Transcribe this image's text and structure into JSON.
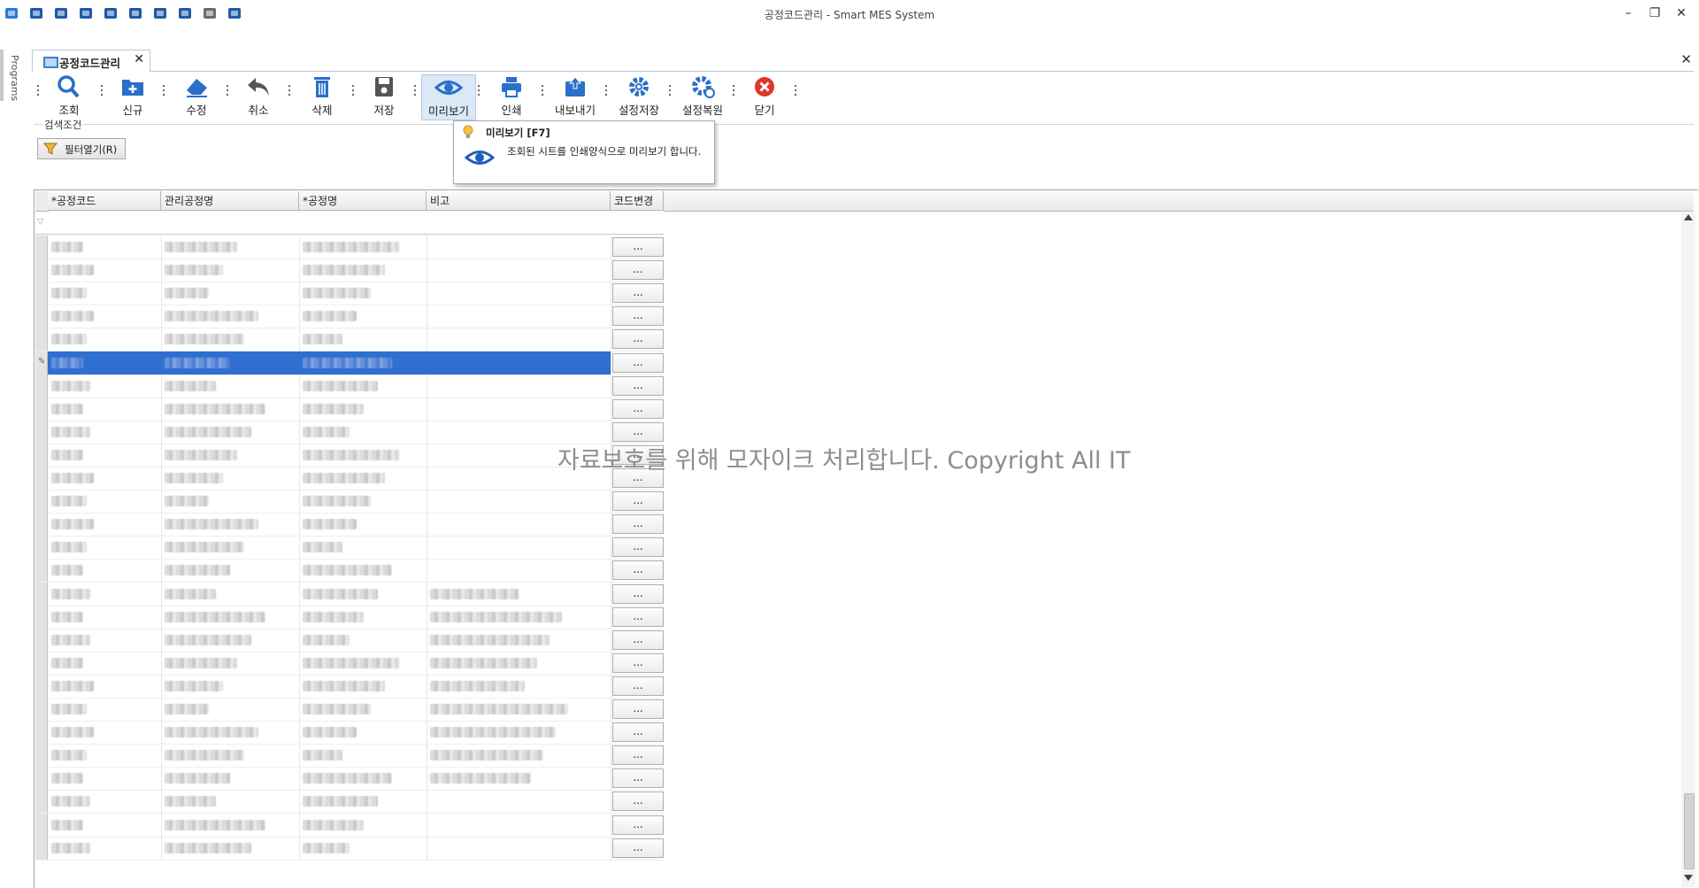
{
  "window": {
    "title": "공정코드관리 - Smart MES System",
    "controls": {
      "minimize": "–",
      "restore": "❐",
      "close": "✕"
    },
    "quick_access_icons": [
      "app-icon",
      "camera-icon",
      "folder-icon",
      "lock-icon",
      "shield-plus-icon",
      "hierarchy-icon",
      "list-icon",
      "windows-icon",
      "palette-icon",
      "palette-alt-icon"
    ]
  },
  "sidebar": {
    "label": "Programs"
  },
  "tab": {
    "label": "공정코드관리",
    "close": "✕"
  },
  "doc_close": "✕",
  "toolbar": {
    "buttons": [
      {
        "id": "search",
        "label": "조회",
        "icon": "magnifier-icon",
        "color": "#2a6fc9"
      },
      {
        "id": "new",
        "label": "신규",
        "icon": "folder-plus-icon",
        "color": "#2a6fc9"
      },
      {
        "id": "edit",
        "label": "수정",
        "icon": "eraser-icon",
        "color": "#2a6fc9"
      },
      {
        "id": "cancel",
        "label": "취소",
        "icon": "undo-icon",
        "color": "#555555"
      },
      {
        "id": "delete",
        "label": "삭제",
        "icon": "trash-icon",
        "color": "#2a6fc9"
      },
      {
        "id": "save",
        "label": "저장",
        "icon": "floppy-icon",
        "color": "#555555"
      },
      {
        "id": "preview",
        "label": "미리보기",
        "icon": "eye-icon",
        "color": "#2a6fc9"
      },
      {
        "id": "print",
        "label": "인쇄",
        "icon": "printer-icon",
        "color": "#2a6fc9"
      },
      {
        "id": "export",
        "label": "내보내기",
        "icon": "export-icon",
        "color": "#2a6fc9"
      },
      {
        "id": "save_settings",
        "label": "설정저장",
        "icon": "gear-icon",
        "color": "#2a6fc9"
      },
      {
        "id": "restore_settings",
        "label": "설정복원",
        "icon": "gear-refresh-icon",
        "color": "#2a6fc9"
      },
      {
        "id": "close",
        "label": "닫기",
        "icon": "close-circle-icon",
        "color": "#e0352b"
      }
    ]
  },
  "search": {
    "legend": "검색조건",
    "filter_button": "필터열기(R)"
  },
  "tooltip": {
    "title": "미리보기 [F7]",
    "description": "조회된 시트를 인쇄양식으로 미리보기 합니다."
  },
  "grid": {
    "columns": [
      "*공정코드",
      "관리공정명",
      "*공정명",
      "비고",
      "코드변경"
    ],
    "row_button_label": "...",
    "row_count": 27,
    "selected_row_index": 5
  },
  "watermark": "자료보호를 위해 모자이크 처리합니다. Copyright All IT"
}
